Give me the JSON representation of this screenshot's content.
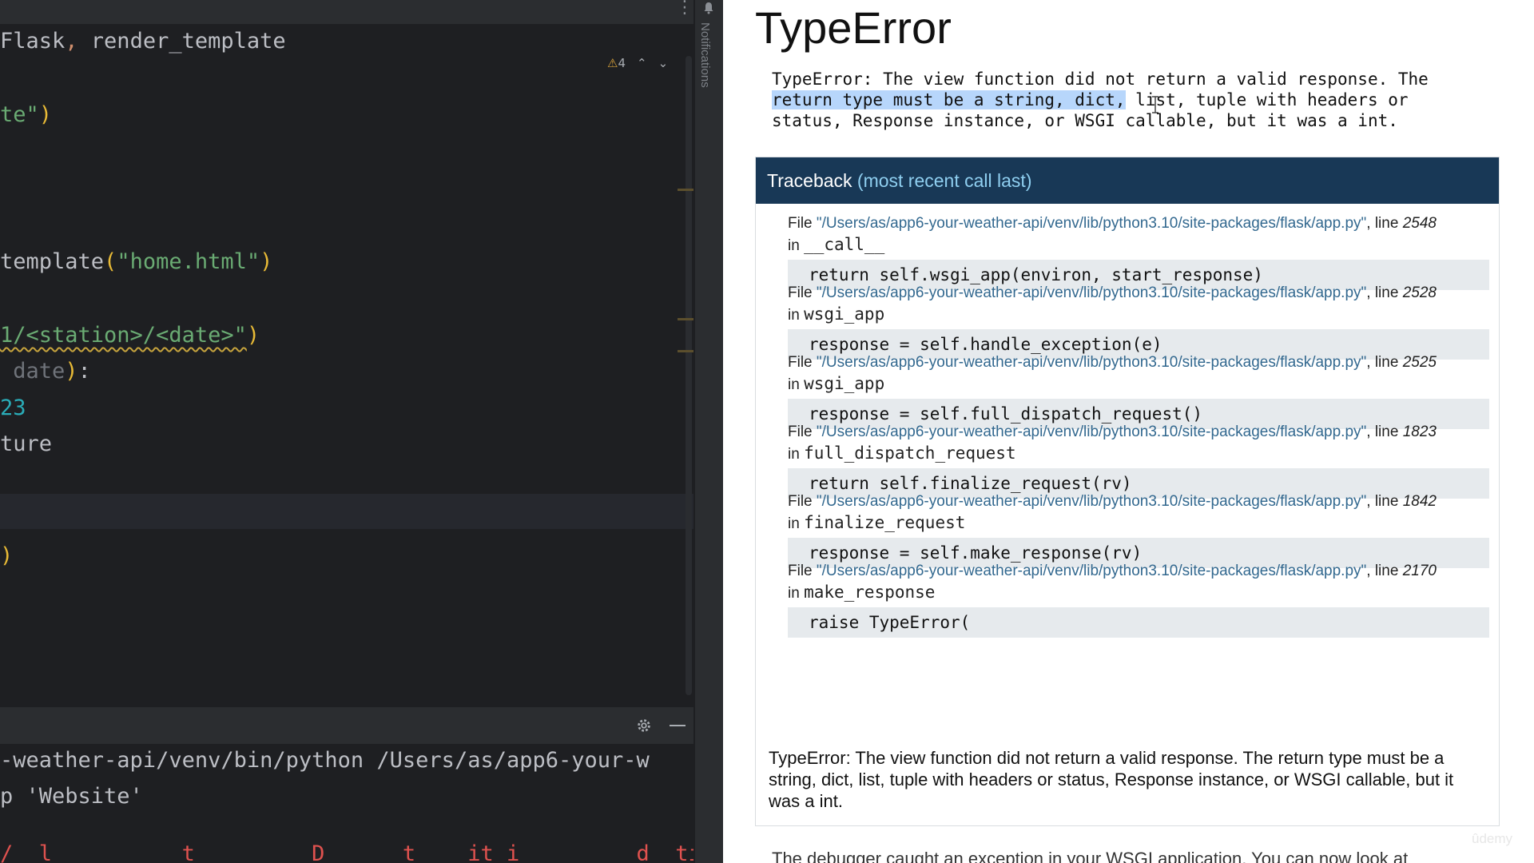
{
  "ide": {
    "inspection_count": "4",
    "code_lines": [
      {
        "id": "line-imports",
        "parts": [
          {
            "t": "Flask",
            "c": ""
          },
          {
            "t": ", ",
            "c": "kw"
          },
          {
            "t": "render_template",
            "c": ""
          }
        ]
      },
      {
        "id": "line-route-home",
        "parts": [
          {
            "t": "te\"",
            "c": "str"
          },
          {
            "t": ")",
            "c": "par"
          }
        ]
      },
      {
        "id": "line-return-template",
        "parts": [
          {
            "t": "template",
            "c": ""
          },
          {
            "t": "(",
            "c": "par"
          },
          {
            "t": "\"home.html\"",
            "c": "str"
          },
          {
            "t": ")",
            "c": "par"
          }
        ]
      },
      {
        "id": "line-route-api",
        "parts": [
          {
            "t": "1/<station>/<date>\"",
            "c": "str wavy"
          },
          {
            "t": ")",
            "c": "par"
          }
        ]
      },
      {
        "id": "line-def-about",
        "parts": [
          {
            "t": " date",
            "c": "dim"
          },
          {
            "t": ")",
            "c": "par"
          },
          {
            "t": ":",
            "c": ""
          }
        ]
      },
      {
        "id": "line-temperature-value",
        "parts": [
          {
            "t": "23",
            "c": "num"
          }
        ]
      },
      {
        "id": "line-temperature-var",
        "parts": [
          {
            "t": "ture",
            "c": ""
          }
        ]
      },
      {
        "id": "line-closing-paren",
        "parts": [
          {
            "t": ")",
            "c": "par"
          }
        ]
      }
    ],
    "run_lines": [
      {
        "id": "run-line-command",
        "text": "-weather-api/venv/bin/python /Users/as/app6-your-w",
        "cls": ""
      },
      {
        "id": "run-line-serving",
        "text": "p 'Website'",
        "cls": ""
      },
      {
        "id": "run-line-warning",
        "text": "/  l          t         D      t    it i         d  ti",
        "cls": "run-err"
      }
    ],
    "notifications_label": "Notifications"
  },
  "browser": {
    "title": "TypeError",
    "message_highlight": "return type must be a string, dict,",
    "message_part1": "TypeError: The view function did not return a valid response. The\n",
    "message_part2": " list, tuple with headers or\nstatus, Response instance, or WSGI callable, but it was a int.",
    "traceback_title": "Traceback",
    "traceback_subtitle": "(most recent call last)",
    "file_word": "File ",
    "line_word": ", line ",
    "in_word": "in ",
    "frames": [
      {
        "path": "\"/Users/as/app6-your-weather-api/venv/lib/python3.10/site-packages/flask/app.py\"",
        "line": "2548",
        "func": "__call__",
        "code": "return self.wsgi_app(environ, start_response)"
      },
      {
        "path": "\"/Users/as/app6-your-weather-api/venv/lib/python3.10/site-packages/flask/app.py\"",
        "line": "2528",
        "func": "wsgi_app",
        "code": "response = self.handle_exception(e)"
      },
      {
        "path": "\"/Users/as/app6-your-weather-api/venv/lib/python3.10/site-packages/flask/app.py\"",
        "line": "2525",
        "func": "wsgi_app",
        "code": "response = self.full_dispatch_request()"
      },
      {
        "path": "\"/Users/as/app6-your-weather-api/venv/lib/python3.10/site-packages/flask/app.py\"",
        "line": "1823",
        "func": "full_dispatch_request",
        "code": "return self.finalize_request(rv)"
      },
      {
        "path": "\"/Users/as/app6-your-weather-api/venv/lib/python3.10/site-packages/flask/app.py\"",
        "line": "1842",
        "func": "finalize_request",
        "code": "response = self.make_response(rv)"
      },
      {
        "path": "\"/Users/as/app6-your-weather-api/venv/lib/python3.10/site-packages/flask/app.py\"",
        "line": "2170",
        "func": "make_response",
        "code": "raise TypeError("
      }
    ],
    "plain_message": "TypeError: The view function did not return a valid response. The return type must be a string, dict, list, tuple with headers or status, Response instance, or WSGI callable, but it was a int.",
    "footer_text": "The debugger caught an exception in your WSGI application. You can now look at",
    "watermark": "ûdemy"
  }
}
